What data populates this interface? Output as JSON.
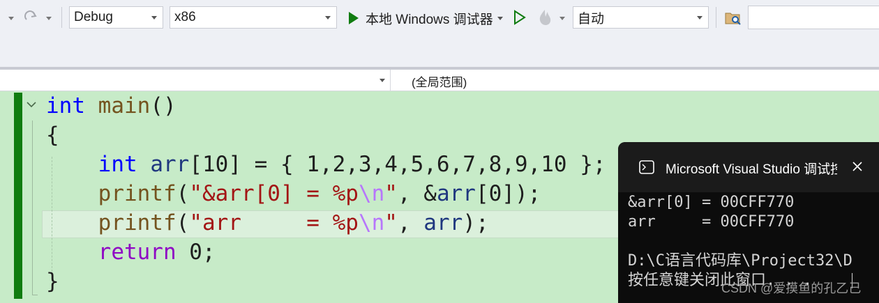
{
  "toolbar": {
    "config": "Debug",
    "platform": "x86",
    "debugger_label": "本地 Windows 调试器",
    "solution_dropdown": "自动",
    "accent": "#107c10"
  },
  "navbar": {
    "scope": "(全局范围)"
  },
  "editor": {
    "line1": {
      "kw": "int",
      "name": "main",
      "rest": "()"
    },
    "line2": "{",
    "line3": {
      "kw": "int",
      "arr": "arr",
      "rest1": "[10] = { 1,2,3,4,5,6,7,8,9,10 };"
    },
    "line4": {
      "fn": "printf",
      "p1": "(",
      "s1": "\"&arr[0] = %p",
      "esc": "\\n",
      "s2": "\"",
      "p2": ", &",
      "arr": "arr",
      "p3": "[0]);"
    },
    "line5": {
      "fn": "printf",
      "p1": "(",
      "s1": "\"arr     = %p",
      "esc": "\\n",
      "s2": "\"",
      "p2": ", ",
      "arr": "arr",
      "p3": ");"
    },
    "line6": {
      "kw": "return",
      "rest": " 0;"
    },
    "line7": "}"
  },
  "console": {
    "title": "Microsoft Visual Studio 调试控",
    "lines": [
      "&arr[0] = 00CFF770",
      "arr     = 00CFF770",
      "",
      "D:\\C语言代码库\\Project32\\D",
      "按任意键关闭此窗口. . ."
    ]
  },
  "watermark": "CSDN @爱摸鱼的孔乙己"
}
